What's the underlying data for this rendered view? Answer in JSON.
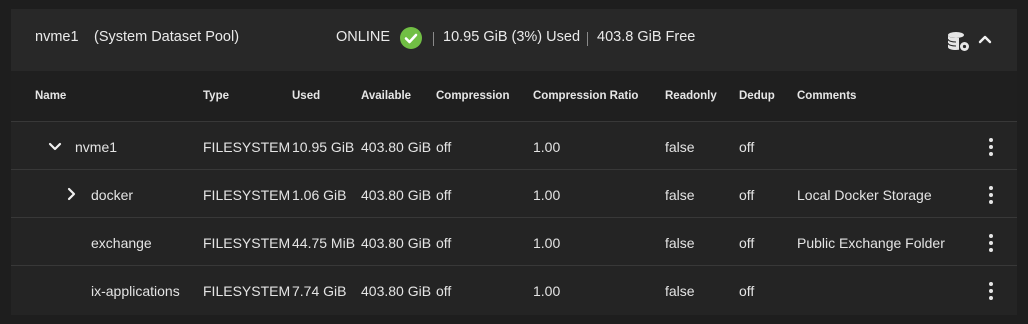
{
  "pool": {
    "name": "nvme1",
    "role": "(System Dataset Pool)",
    "status": "ONLINE",
    "status_color": "#71bf44",
    "used": "10.95 GiB (3%) Used",
    "free": "403.8 GiB Free",
    "actions_icon": "dataset-settings-icon",
    "collapse_icon": "chevron-up-icon"
  },
  "columns": [
    "Name",
    "Type",
    "Used",
    "Available",
    "Compression",
    "Compression Ratio",
    "Readonly",
    "Dedup",
    "Comments"
  ],
  "rows": [
    {
      "name": "nvme1",
      "type": "FILESYSTEM",
      "used": "10.95 GiB",
      "available": "403.80 GiB",
      "compression": "off",
      "ratio": "1.00",
      "readonly": "false",
      "dedup": "off",
      "comments": "",
      "toggle": "chevron-down-icon"
    },
    {
      "name": "docker",
      "type": "FILESYSTEM",
      "used": "1.06 GiB",
      "available": "403.80 GiB",
      "compression": "off",
      "ratio": "1.00",
      "readonly": "false",
      "dedup": "off",
      "comments": "Local Docker Storage",
      "toggle": "chevron-right-icon"
    },
    {
      "name": "exchange",
      "type": "FILESYSTEM",
      "used": "44.75 MiB",
      "available": "403.80 GiB",
      "compression": "off",
      "ratio": "1.00",
      "readonly": "false",
      "dedup": "off",
      "comments": "Public Exchange Folder",
      "toggle": ""
    },
    {
      "name": "ix-applications",
      "type": "FILESYSTEM",
      "used": "7.74 GiB",
      "available": "403.80 GiB",
      "compression": "off",
      "ratio": "1.00",
      "readonly": "false",
      "dedup": "off",
      "comments": "",
      "toggle": ""
    }
  ]
}
